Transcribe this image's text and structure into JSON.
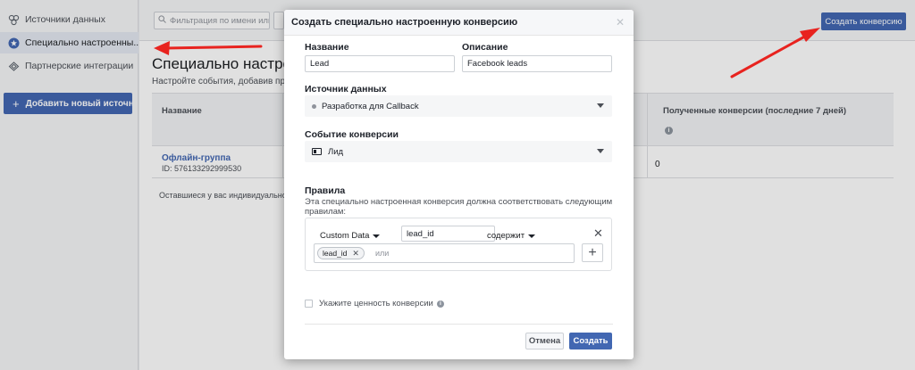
{
  "sidebar": {
    "items": [
      {
        "label": "Источники данных",
        "icon": "data-sources-icon"
      },
      {
        "label": "Специально настроенны...",
        "icon": "star-badge-icon",
        "active": true
      },
      {
        "label": "Партнерские интеграции",
        "icon": "integrations-icon"
      }
    ],
    "add_button": "Добавить новый источни...",
    "add_icon": "plus-icon"
  },
  "topbar": {
    "filter_placeholder": "Фильтрация по имени или ID",
    "create_button": "Создать конверсию"
  },
  "page": {
    "title": "Специально настро",
    "subtitle": "Настройте события, добавив прави",
    "table": {
      "col_name": "Название",
      "col_received": "Полученные конверсии (последние 7 дней)",
      "row_name": "Офлайн-группа",
      "row_id": "ID: 576133292999530",
      "row_value": "0"
    },
    "remaining": "Оставшиеся у вас индивидуально на"
  },
  "modal": {
    "title": "Создать специально настроенную конверсию",
    "name_label": "Название",
    "name_value": "Lead",
    "desc_label": "Описание",
    "desc_value": "Facebook leads",
    "source_label": "Источник данных",
    "source_value": "Разработка для Callback",
    "event_label": "Событие конверсии",
    "event_value": "Лид",
    "rules_label": "Правила",
    "rules_desc": "Эта специально настроенная конверсия должна соответствовать следующим правилам:",
    "rule": {
      "field": "Custom Data",
      "key": "lead_id",
      "operator": "содержит",
      "tag": "lead_id",
      "or_placeholder": "или"
    },
    "value_checkbox": "Укажите ценность конверсии",
    "cancel": "Отмена",
    "create": "Создать"
  },
  "colors": {
    "accent": "#4267b2",
    "arrow": "#e8231f"
  }
}
